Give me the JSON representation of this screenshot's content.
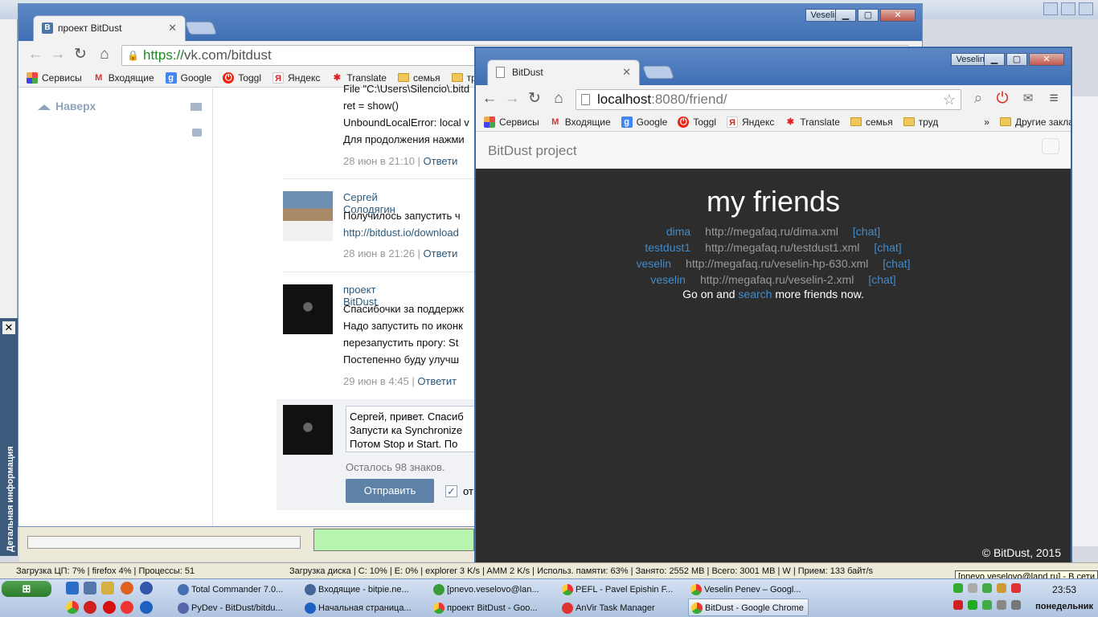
{
  "desktop": {
    "outer_title_user": "Veselin",
    "left_panel_label": "Детальная информация"
  },
  "vk_window": {
    "tab_title": "проект BitDust",
    "url_https": "https://",
    "url_rest": "vk.com/bitdust",
    "user_tag": "Veselin",
    "side_top": "Наверх",
    "bookmarks": [
      "Сервисы",
      "Входящие",
      "Google",
      "Toggl",
      "Яндекс",
      "Translate",
      "семья",
      "труд"
    ],
    "error_lines": [
      "File \"C:\\Users\\Silencio\\.bitd",
      "ret = show()",
      "UnboundLocalError: local v",
      "Для продолжения нажми"
    ],
    "meta1_date": "28 июн в 21:10",
    "meta1_reply": "Ответи",
    "comment2_name": "Сергей Солодягин",
    "comment2_lines": [
      "Получилось запустить ч",
      "http://bitdust.io/download"
    ],
    "meta2_date": "28 июн в 21:26",
    "meta2_reply": "Ответи",
    "comment3_name": "проект BitDust",
    "comment3_lines": [
      "Спасибочки за поддержк",
      "Надо запустить по иконк",
      "перезапустить прогу: St",
      "Постепенно буду улучш"
    ],
    "meta3_date": "29 июн в 4:45",
    "meta3_reply": "Ответит",
    "draft_lines": [
      "Сергей, привет. Спасиб",
      "Запусти ка Synchronize",
      "Потом Stop и Start. По"
    ],
    "chars_left": "Осталось 98 знаков.",
    "send_label": "Отправить",
    "checkbox_label": "от"
  },
  "bitdust_window": {
    "tab_title": "BitDust",
    "user_tag": "Veselin",
    "url_host": "localhost",
    "url_rest": ":8080/friend/",
    "bookmarks": [
      "Сервисы",
      "Входящие",
      "Google",
      "Toggl",
      "Яндекс",
      "Translate",
      "семья",
      "труд"
    ],
    "bookmarks_more": "»",
    "other_bookmarks": "Другие закладки",
    "brand": "BitDust project",
    "title": "my friends",
    "friends": [
      {
        "name": "dima",
        "url": "http://megafaq.ru/dima.xml",
        "chat": "[chat]"
      },
      {
        "name": "testdust1",
        "url": "http://megafaq.ru/testdust1.xml",
        "chat": "[chat]"
      },
      {
        "name": "veselin",
        "url": "http://megafaq.ru/veselin-hp-630.xml",
        "chat": "[chat]"
      },
      {
        "name": "veselin",
        "url": "http://megafaq.ru/veselin-2.xml",
        "chat": "[chat]"
      }
    ],
    "go_prefix": "Go on and",
    "go_link": "search",
    "go_suffix": "more friends now.",
    "footer": "© BitDust, 2015"
  },
  "statusbar": {
    "cpu": "Загрузка ЦП: 7% | firefox 4% | Процессы: 51",
    "disk": "Загрузка диска | C: 10% | E: 0% | explorer 3 K/s | AMM 2 K/s | Использ. памяти: 63% | Занято: 2552 MB | Всего: 3001 MB | W | Прием: 133 байт/s",
    "tray_tooltip": "[pnevo.veselovo@land.ru] - В сети"
  },
  "taskbar": {
    "row1": [
      "Total Commander 7.0...",
      "Входящие - bitpie.ne...",
      "[pnevo.veselovo@lan...",
      "PEFL - Pavel Epishin F...",
      "Veselin Penev – Googl..."
    ],
    "row2": [
      "PyDev - BitDust/bitdu...",
      "Начальная страница...",
      "проект BitDust - Goo...",
      "AnVir Task Manager",
      "BitDust - Google Chrome"
    ],
    "time": "23:53",
    "day": "понедельник"
  }
}
